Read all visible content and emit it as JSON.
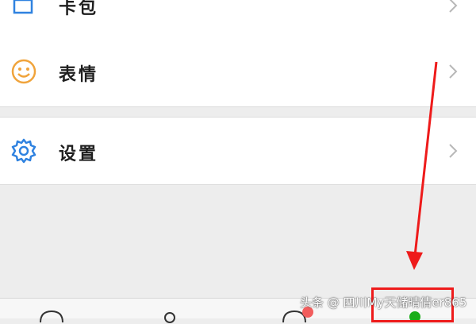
{
  "menu": {
    "items": [
      {
        "label": "卡包",
        "icon": "wallet-icon"
      },
      {
        "label": "表情",
        "icon": "smiley-icon"
      },
      {
        "label": "设置",
        "icon": "gear-icon"
      }
    ]
  },
  "tabbar": {
    "tabs": [
      {
        "icon": "chat-bubble-icon"
      },
      {
        "icon": "contacts-icon"
      },
      {
        "icon": "discover-compass-icon",
        "badge": true
      },
      {
        "icon": "me-icon",
        "active": true
      }
    ]
  },
  "watermark": "头条 @ 四川My天储晴倩er865",
  "colors": {
    "accent_blue": "#2f82e0",
    "emoji_orange": "#f0a43c",
    "annotation_red": "#ee1b1b",
    "active_green": "#1aad19",
    "badge_red": "#f25d5d"
  }
}
